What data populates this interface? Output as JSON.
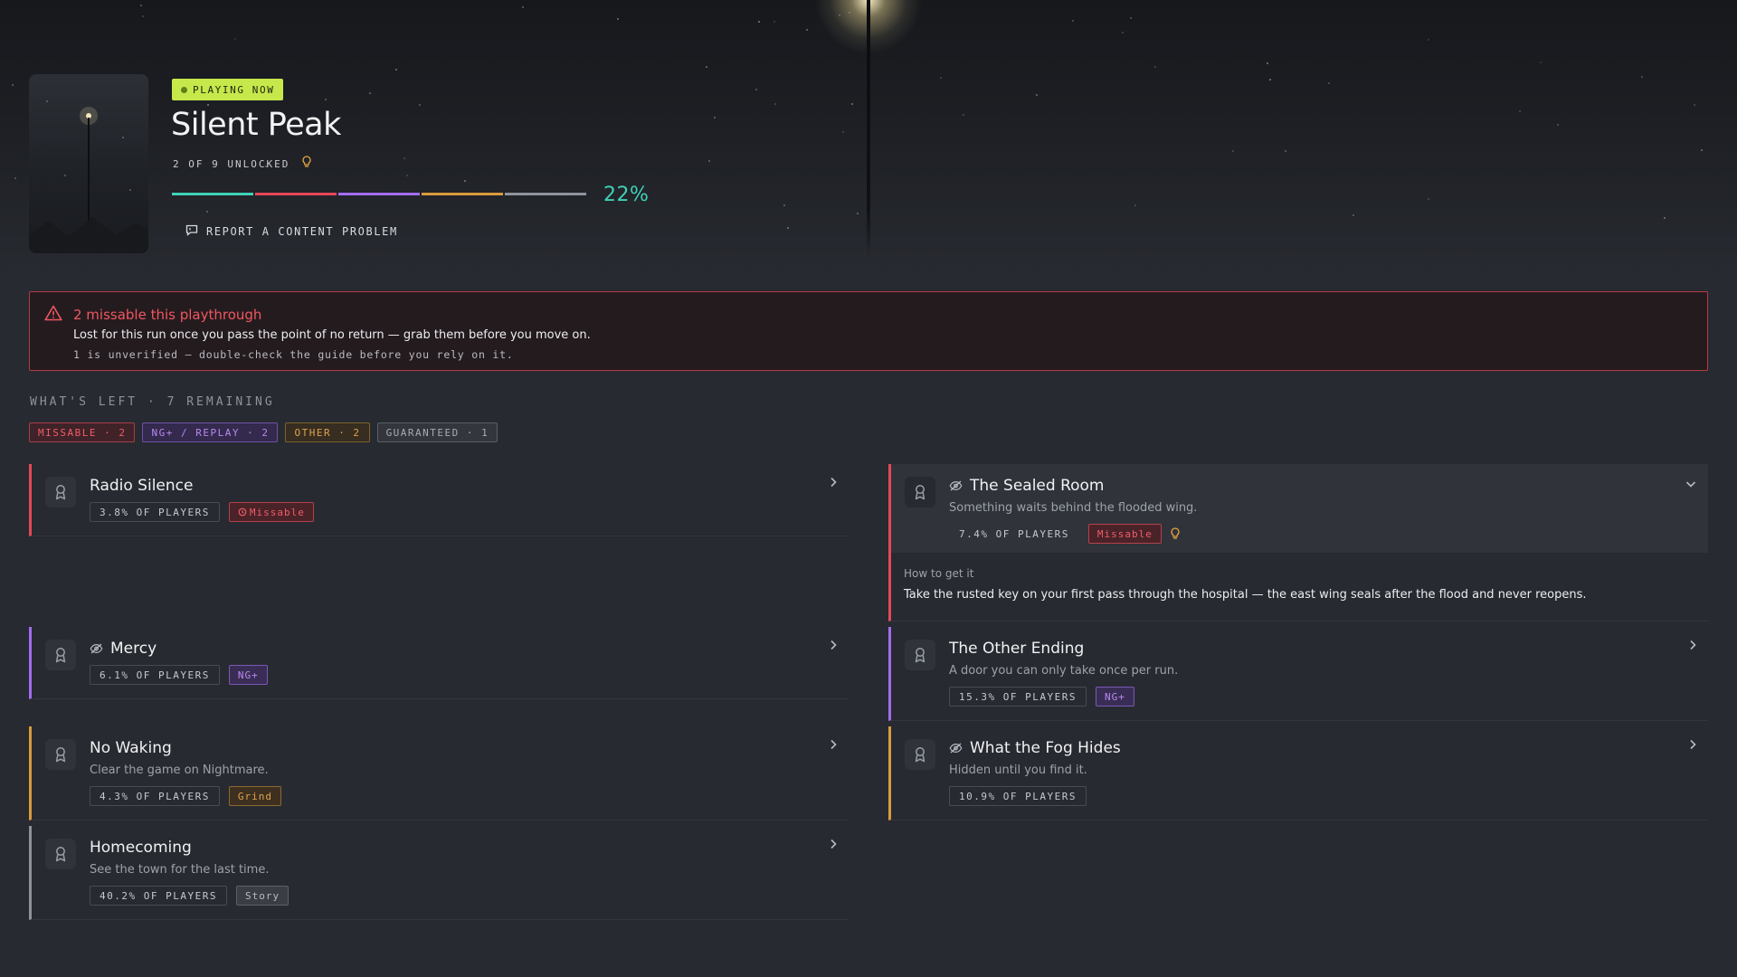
{
  "game": {
    "status_badge": "PLAYING NOW",
    "title": "Silent Peak",
    "unlocked_text": "2 OF 9 UNLOCKED",
    "progress_percent": 22,
    "progress_label": "22%",
    "progress_segments": [
      "#3fd1b6",
      "#e5485a",
      "#a46cf0",
      "#d99a3e",
      "#8e939c"
    ],
    "report_label": "REPORT A CONTENT PROBLEM"
  },
  "banner": {
    "title": "2 missable this playthrough",
    "text": "Lost for this run once you pass the point of no return — grab them before you move on.",
    "note": "1 is unverified — double-check the guide before you rely on it."
  },
  "section": {
    "title": "WHAT'S LEFT · 7 REMAINING",
    "filters": [
      {
        "label": "MISSABLE · 2",
        "color": "#f05c66"
      },
      {
        "label": "NG+ / REPLAY · 2",
        "color": "#b888f0"
      },
      {
        "label": "OTHER · 2",
        "color": "#e0a24c"
      },
      {
        "label": "GUARANTEED · 1",
        "color": "#9aa0a8"
      }
    ]
  },
  "achievements": {
    "radio_silence": {
      "title": "Radio Silence",
      "stat": "3.8% OF PLAYERS",
      "tag": "Missable",
      "accent": "#e5485a"
    },
    "mercy": {
      "title": "Mercy",
      "stat": "6.1% OF PLAYERS",
      "tag": "NG+",
      "accent": "#a46cf0",
      "hidden": true
    },
    "no_waking": {
      "title": "No Waking",
      "desc": "Clear the game on Nightmare.",
      "stat": "4.3% OF PLAYERS",
      "tag": "Grind",
      "accent": "#d99a3e"
    },
    "homecoming": {
      "title": "Homecoming",
      "desc": "See the town for the last time.",
      "stat": "40.2% OF PLAYERS",
      "tag": "Story",
      "accent": "#8e939c"
    },
    "sealed_room": {
      "title": "The Sealed Room",
      "desc": "Something waits behind the flooded wing.",
      "stat": "7.4% OF PLAYERS",
      "tag": "Missable",
      "accent": "#e5485a",
      "hidden": true,
      "how_label": "How to get it",
      "how_text": "Take the rusted key on your first pass through the hospital — the east wing seals after the flood and never reopens."
    },
    "other_ending": {
      "title": "The Other Ending",
      "desc": "A door you can only take once per run.",
      "stat": "15.3% OF PLAYERS",
      "tag": "NG+",
      "accent": "#a46cf0"
    },
    "fog_hides": {
      "title": "What the Fog Hides",
      "desc": "Hidden until you find it.",
      "stat": "10.9% OF PLAYERS",
      "accent": "#d99a3e",
      "hidden": true
    }
  }
}
